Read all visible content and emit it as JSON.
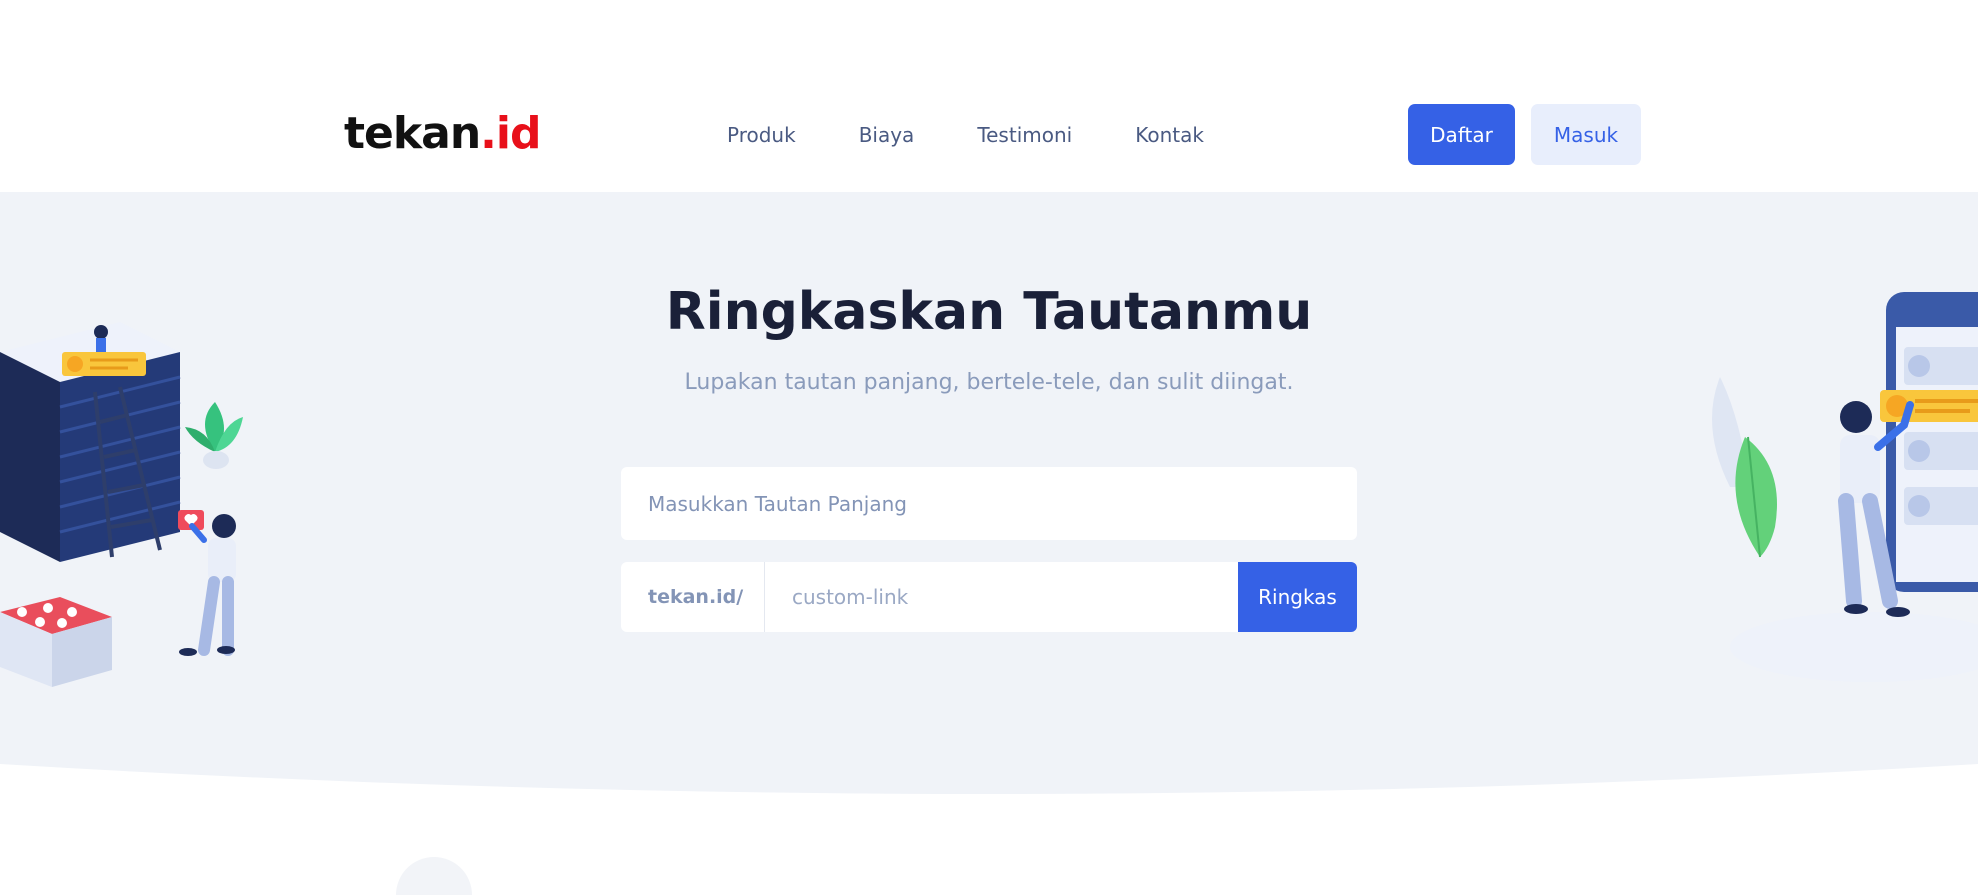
{
  "brand": {
    "logo_main": "tekan",
    "logo_accent": ".id"
  },
  "nav": {
    "items": [
      {
        "label": "Produk"
      },
      {
        "label": "Biaya"
      },
      {
        "label": "Testimoni"
      },
      {
        "label": "Kontak"
      }
    ]
  },
  "auth": {
    "register_label": "Daftar",
    "login_label": "Masuk"
  },
  "hero": {
    "title": "Ringkaskan Tautanmu",
    "subtitle": "Lupakan tautan panjang, bertele-tele, dan sulit diingat."
  },
  "shortener": {
    "long_url_placeholder": "Masukkan Tautan Panjang",
    "prefix": "tekan.id/",
    "custom_placeholder": "custom-link",
    "submit_label": "Ringkas"
  },
  "colors": {
    "accent": "#3561e6",
    "logo_accent": "#e8101a",
    "hero_bg": "#f0f3f8"
  },
  "icons": [
    "heart-icon",
    "chat-bubble-icon",
    "plant-icon",
    "smartphone-icon"
  ]
}
